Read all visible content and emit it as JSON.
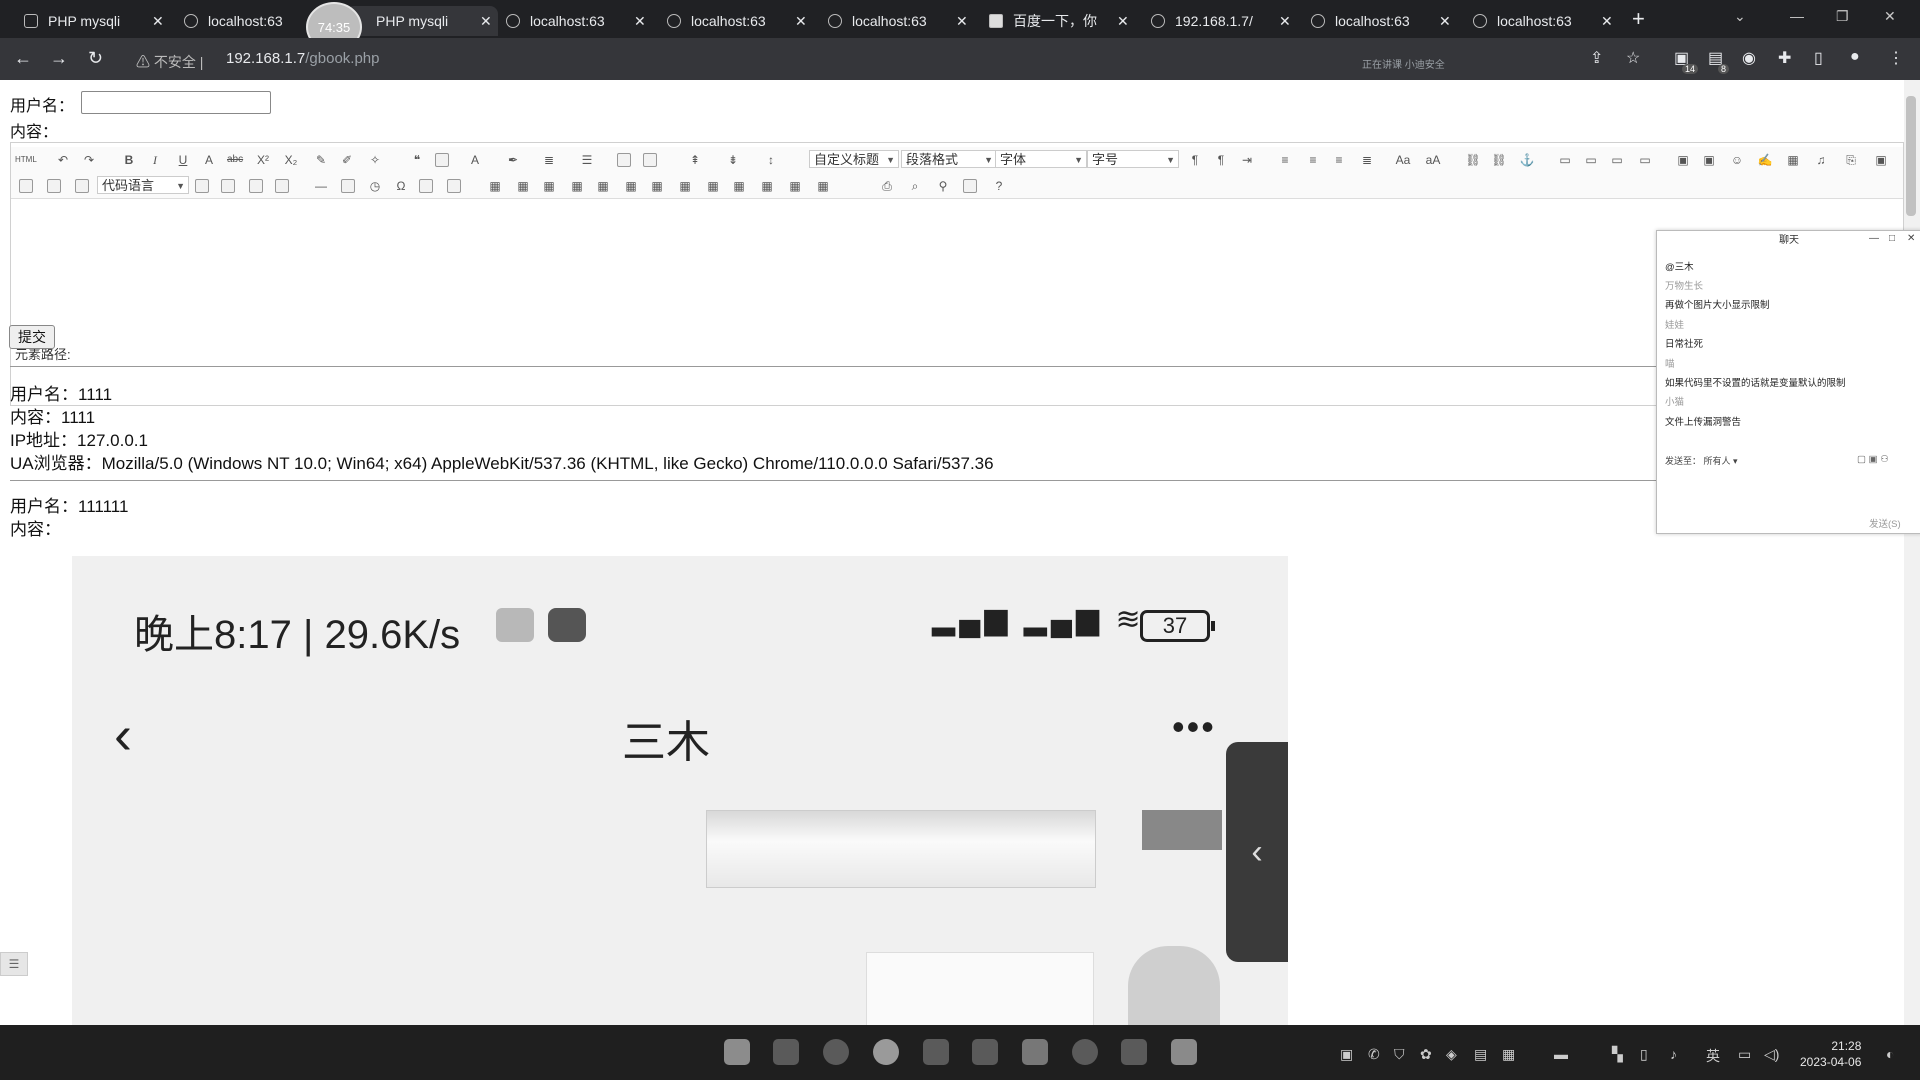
{
  "browser": {
    "tabs": [
      {
        "label": "PHP mysqli",
        "icon": "php-icon"
      },
      {
        "label": "localhost:63",
        "icon": "globe-icon"
      },
      {
        "label": "PHP mysqli",
        "icon": "php-icon"
      },
      {
        "label": "localhost:63",
        "icon": "globe-icon"
      },
      {
        "label": "localhost:63",
        "icon": "globe-icon"
      },
      {
        "label": "localhost:63",
        "icon": "globe-icon"
      },
      {
        "label": "百度一下，你",
        "icon": "baidu-icon"
      },
      {
        "label": "192.168.1.7/",
        "icon": "globe-icon"
      },
      {
        "label": "localhost:63",
        "icon": "globe-icon"
      },
      {
        "label": "localhost:63",
        "icon": "globe-icon"
      }
    ],
    "timer": "74:35",
    "security_label": "不安全",
    "url_host": "192.168.1.7",
    "url_path": "/gbook.php",
    "status_text": "正在讲课 小迪安全",
    "badge1": "14",
    "badge2": "8"
  },
  "form": {
    "username_label": "用户名：",
    "content_label": "内容：",
    "element_path_label": "元素路径:",
    "submit_label": "提交",
    "toolbar": {
      "custom_heading": "自定义标题",
      "paragraph_format": "段落格式",
      "font_family": "字体",
      "font_size": "字号",
      "code_language": "代码语言"
    }
  },
  "messages": [
    {
      "username": "用户名：1111",
      "content": "内容：1111",
      "ip": "IP地址：127.0.0.1",
      "ua": "UA浏览器：Mozilla/5.0 (Windows NT 10.0; Win64; x64) AppleWebKit/537.36 (KHTML, like Gecko) Chrome/110.0.0.0 Safari/537.36"
    },
    {
      "username": "用户名：111111",
      "content": "内容："
    }
  ],
  "phone_screenshot": {
    "status_time": "晚上8:17 | 29.6K/s",
    "battery": "37",
    "chat_title": "三木"
  },
  "chat_window": {
    "title": "聊天",
    "messages": [
      {
        "text": "@三木",
        "kind": "t"
      },
      {
        "text": "万物生长",
        "kind": "n"
      },
      {
        "text": "再做个图片大小显示限制",
        "kind": "t"
      },
      {
        "text": "娃娃",
        "kind": "n"
      },
      {
        "text": "日常社死",
        "kind": "t"
      },
      {
        "text": "喵",
        "kind": "n"
      },
      {
        "text": "如果代码里不设置的话就是变量默认的限制",
        "kind": "t"
      },
      {
        "text": "小猫",
        "kind": "n"
      },
      {
        "text": "文件上传漏洞警告",
        "kind": "t"
      }
    ],
    "send_to_label": "发送至：",
    "send_to_value": "所有人",
    "send_button": "发送(S)"
  },
  "taskbar": {
    "time": "21:28",
    "date": "2023-04-06",
    "ime": "英"
  }
}
